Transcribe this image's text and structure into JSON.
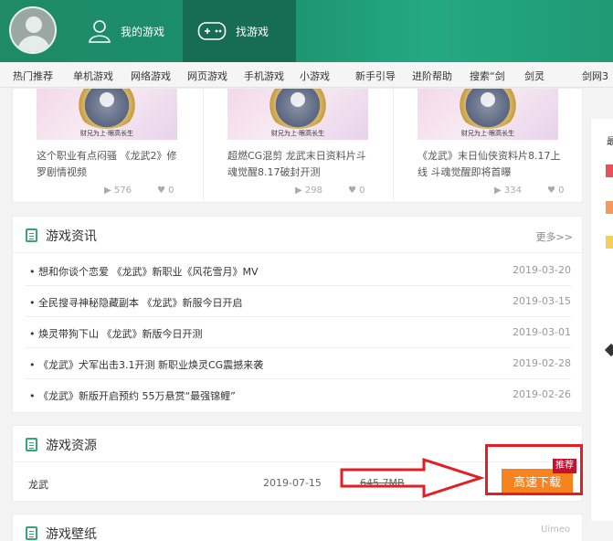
{
  "header": {
    "tabs": [
      {
        "label": "我的游戏",
        "icon": "user-icon"
      },
      {
        "label": "找游戏",
        "icon": "gamepad-icon",
        "active": true
      }
    ]
  },
  "nav": {
    "items": [
      "热门推荐",
      "单机游戏",
      "网络游戏",
      "网页游戏",
      "手机游戏",
      "小游戏",
      "新手引导",
      "进阶帮助",
      "搜索“剑",
      "剑灵",
      "剑网3"
    ]
  },
  "videos": [
    {
      "title": "这个职业有点闷骚 《龙武2》修罗剧情视频",
      "plays": "576",
      "likes": "0",
      "caption": "财兄为上·眼高长生"
    },
    {
      "title": "超燃CG混剪 龙武末日资料片斗魂觉醒8.17破封开测",
      "plays": "298",
      "likes": "0",
      "caption": "财兄为上·眼高长生"
    },
    {
      "title": "《龙武》末日仙侠资料片8.17上线 斗魂觉醒即将首曝",
      "plays": "334",
      "likes": "0",
      "caption": "财兄为上·眼高长生"
    }
  ],
  "news": {
    "title": "游戏资讯",
    "more": "更多>>",
    "items": [
      {
        "title": "• 想和你谈个恋爱 《龙武》新职业《风花雪月》MV",
        "date": "2019-03-20"
      },
      {
        "title": "• 全民搜寻神秘隐藏副本 《龙武》新服今日开启",
        "date": "2019-03-15"
      },
      {
        "title": "• 焕灵带狗下山 《龙武》新版今日开测",
        "date": "2019-03-01"
      },
      {
        "title": "• 《龙武》犬军出击3.1开测 新职业焕灵CG震撼来袭",
        "date": "2019-02-28"
      },
      {
        "title": "• 《龙武》新版开启预约 55万悬赏“最强锦鲤”",
        "date": "2019-02-26"
      }
    ]
  },
  "resources": {
    "title": "游戏资源",
    "item": {
      "name": "龙武",
      "date": "2019-07-15",
      "size": "645.7MB"
    },
    "download_label": "高速下载",
    "badge": "推荐",
    "colors": {
      "button": "#f7831e",
      "highlight": "#e31e24"
    }
  },
  "wallpaper": {
    "title": "游戏壁纸"
  },
  "right_column": {
    "heading_char": "最",
    "chip_colors": [
      "#e8505b",
      "#f39a5a",
      "#f5cf5b"
    ]
  },
  "watermark": "Uimeo"
}
